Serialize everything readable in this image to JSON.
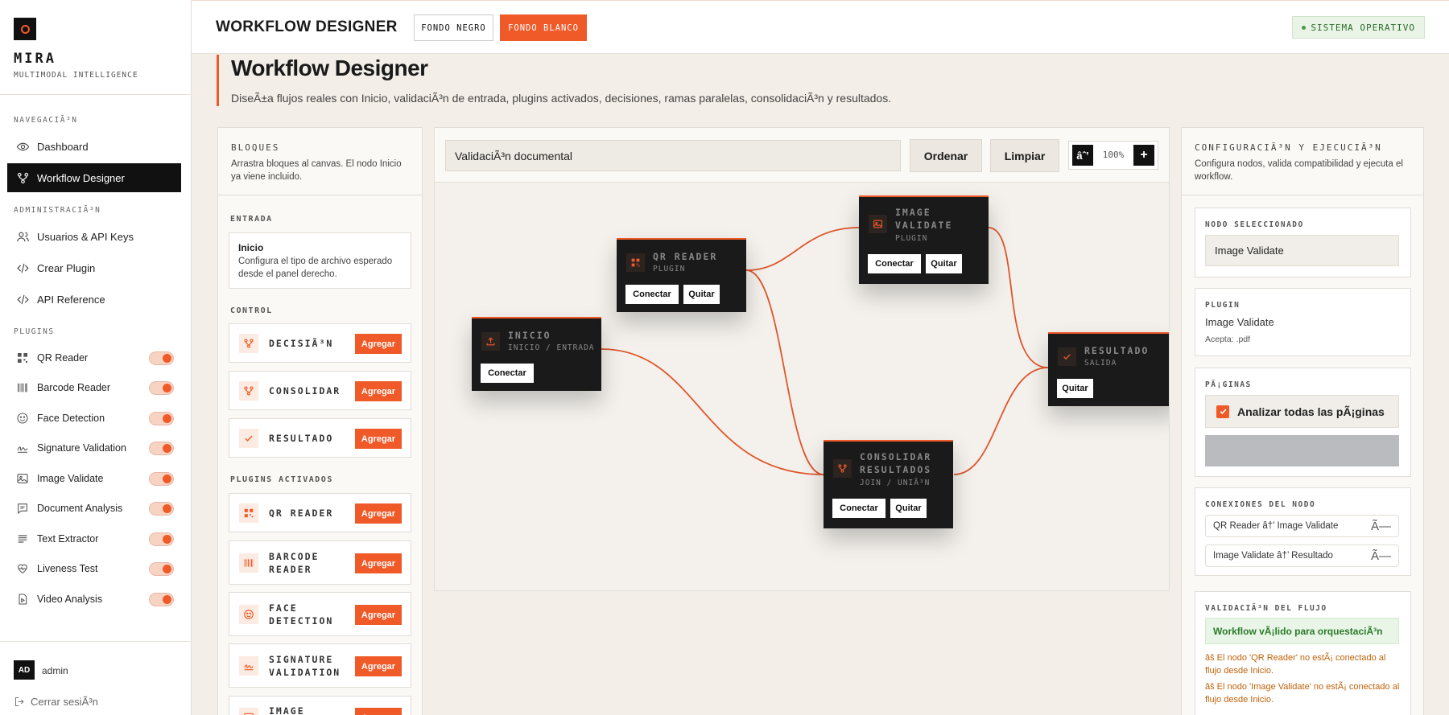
{
  "brand": {
    "name": "MIRA",
    "tagline": "MULTIMODAL INTELLIGENCE"
  },
  "sidebar": {
    "sections": {
      "navigation": "NAVEGACIÃ³N",
      "administration": "ADMINISTRACIÃ³N",
      "plugins": "PLUGINS"
    },
    "nav": [
      {
        "label": "Dashboard",
        "icon": "eye-icon"
      },
      {
        "label": "Workflow Designer",
        "icon": "workflow-icon",
        "active": true
      }
    ],
    "admin": [
      {
        "label": "Usuarios & API Keys",
        "icon": "users-icon"
      },
      {
        "label": "Crear Plugin",
        "icon": "code-icon"
      },
      {
        "label": "API Reference",
        "icon": "code-icon"
      }
    ],
    "plugins": [
      {
        "label": "QR Reader",
        "icon": "qr-icon",
        "enabled": true
      },
      {
        "label": "Barcode Reader",
        "icon": "barcode-icon",
        "enabled": true
      },
      {
        "label": "Face Detection",
        "icon": "face-icon",
        "enabled": true
      },
      {
        "label": "Signature Validation",
        "icon": "signature-icon",
        "enabled": true
      },
      {
        "label": "Image Validate",
        "icon": "image-icon",
        "enabled": true
      },
      {
        "label": "Document Analysis",
        "icon": "document-icon",
        "enabled": true
      },
      {
        "label": "Text Extractor",
        "icon": "text-icon",
        "enabled": true
      },
      {
        "label": "Liveness Test",
        "icon": "heart-pulse-icon",
        "enabled": true
      },
      {
        "label": "Video Analysis",
        "icon": "video-file-icon",
        "enabled": true
      }
    ],
    "user": {
      "initials": "AD",
      "name": "admin"
    },
    "logout": "Cerrar sesiÃ³n"
  },
  "header": {
    "title": "WORKFLOW DESIGNER",
    "theme_dark": "FONDO NEGRO",
    "theme_light": "FONDO BLANCO",
    "status": "SISTEMA OPERATIVO"
  },
  "page": {
    "title": "Workflow Designer",
    "subtitle": "DiseÃ±a flujos reales con Inicio, validaciÃ³n de entrada, plugins activados, decisiones, ramas paralelas, consolidaciÃ³n y resultados."
  },
  "blocks_panel": {
    "title": "BLOQUES",
    "description": "Arrastra bloques al canvas. El nodo Inicio ya viene incluido.",
    "groups": {
      "entrada": "ENTRADA",
      "control": "CONTROL",
      "plugins": "PLUGINS ACTIVADOS"
    },
    "inicio": {
      "title": "Inicio",
      "description": "Configura el tipo de archivo esperado desde el panel derecho."
    },
    "control_blocks": [
      {
        "label": "DECISIÃ³N",
        "icon": "branch-icon"
      },
      {
        "label": "CONSOLIDAR",
        "icon": "merge-icon"
      },
      {
        "label": "RESULTADO",
        "icon": "check-icon"
      }
    ],
    "plugin_blocks": [
      {
        "label": "QR READER",
        "icon": "qr-icon"
      },
      {
        "label": "BARCODE READER",
        "icon": "barcode-icon"
      },
      {
        "label": "FACE DETECTION",
        "icon": "face-icon"
      },
      {
        "label": "SIGNATURE VALIDATION",
        "icon": "signature-icon"
      },
      {
        "label": "IMAGE",
        "icon": "image-icon"
      }
    ],
    "add_label": "Agregar"
  },
  "canvas": {
    "workflow_name": "ValidaciÃ³n documental",
    "order_label": "Ordenar",
    "clear_label": "Limpiar",
    "zoom_out": "âˆ’",
    "zoom": "100%",
    "zoom_in": "+",
    "connect_label": "Conectar",
    "remove_label": "Quitar",
    "nodes": {
      "inicio": {
        "title": "INICIO",
        "subtitle": "INICIO / ENTRADA",
        "icon": "upload-icon"
      },
      "qr": {
        "title": "QR READER",
        "subtitle": "PLUGIN",
        "icon": "qr-icon"
      },
      "image": {
        "title": "IMAGE VALIDATE",
        "subtitle": "PLUGIN",
        "icon": "image-icon"
      },
      "consolidar": {
        "title": "CONSOLIDAR RESULTADOS",
        "subtitle": "JOIN / UNIÃ³N",
        "icon": "merge-icon"
      },
      "resultado": {
        "title": "RESULTADO",
        "subtitle": "SALIDA",
        "icon": "check-icon"
      }
    },
    "connections": [
      [
        "inicio",
        "consolidar"
      ],
      [
        "qr",
        "image"
      ],
      [
        "qr",
        "consolidar"
      ],
      [
        "image",
        "resultado"
      ],
      [
        "consolidar",
        "resultado"
      ]
    ]
  },
  "config_panel": {
    "title": "CONFIGURACIÃ³N Y EJECUCIÃ³N",
    "description": "Configura nodos, valida compatibilidad y ejecuta el workflow.",
    "selected_label": "NODO SELECCIONADO",
    "selected_value": "Image Validate",
    "plugin_label": "PLUGIN",
    "plugin_value": "Image Validate",
    "plugin_accepts": "Acepta: .pdf",
    "pages_label": "PÃ¡GINAS",
    "pages_checkbox": "Analizar todas las pÃ¡ginas",
    "connections_label": "CONEXIONES DEL NODO",
    "connections": [
      {
        "text": "QR Reader â†’ Image Validate",
        "remove": "Ã—"
      },
      {
        "text": "Image Validate â†’ Resultado",
        "remove": "Ã—"
      }
    ],
    "validation_label": "VALIDACIÃ³N DEL FLUJO",
    "validation_ok": "Workflow vÃ¡lido para orquestaciÃ³n",
    "warnings": [
      "âš  El nodo 'QR Reader' no estÃ¡ conectado al flujo desde Inicio.",
      "âš  El nodo 'Image Validate' no estÃ¡ conectado al flujo desde Inicio."
    ]
  },
  "colors": {
    "accent": "#f05a28",
    "dark": "#111111",
    "background": "#f3eee8",
    "ok": "#2a7a2a",
    "warning": "#c0620a"
  }
}
